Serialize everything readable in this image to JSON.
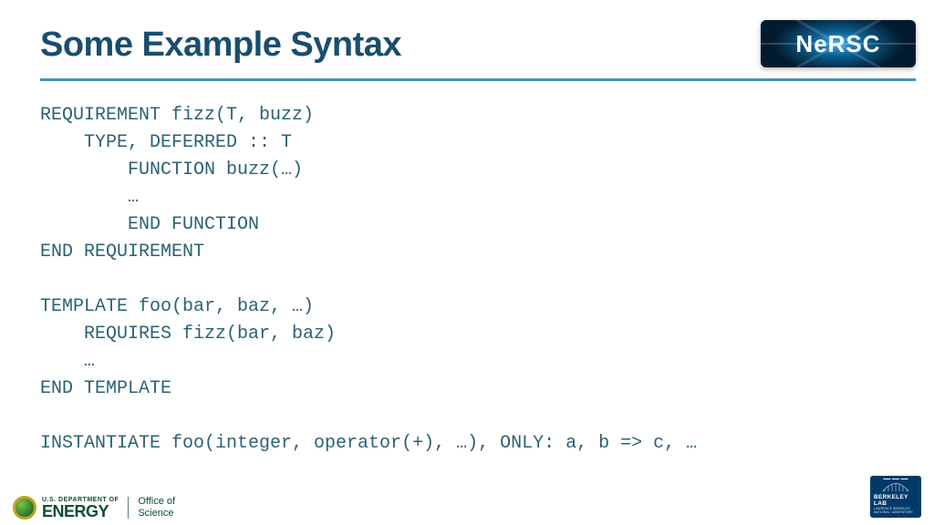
{
  "title": "Some Example Syntax",
  "nersc": "NeRSC",
  "code": {
    "l1": "REQUIREMENT fizz(T, buzz)",
    "l2": "    TYPE, DEFERRED :: T",
    "l3": "        FUNCTION buzz(…)",
    "l4": "        …",
    "l5": "        END FUNCTION",
    "l6": "END REQUIREMENT",
    "l7": "",
    "l8": "TEMPLATE foo(bar, baz, …)",
    "l9": "    REQUIRES fizz(bar, baz)",
    "l10": "    …",
    "l11": "END TEMPLATE",
    "l12": "",
    "l13": "INSTANTIATE foo(integer, operator(+), …), ONLY: a, b => c, …"
  },
  "footer": {
    "dept": "U.S. DEPARTMENT OF",
    "energy": "ENERGY",
    "office1": "Office of",
    "office2": "Science",
    "lbnl": "BERKELEY LAB",
    "lbnl_sub": "LAWRENCE BERKELEY NATIONAL LABORATORY"
  }
}
